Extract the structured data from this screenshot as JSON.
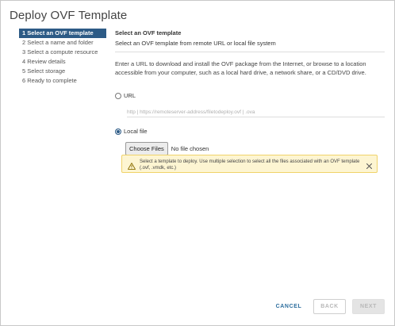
{
  "dialog": {
    "title": "Deploy OVF Template"
  },
  "steps": [
    {
      "label": "1 Select an OVF template",
      "active": true
    },
    {
      "label": "2 Select a name and folder",
      "active": false
    },
    {
      "label": "3 Select a compute resource",
      "active": false
    },
    {
      "label": "4 Review details",
      "active": false
    },
    {
      "label": "5 Select storage",
      "active": false
    },
    {
      "label": "6 Ready to complete",
      "active": false
    }
  ],
  "main": {
    "heading": "Select an OVF template",
    "subheading": "Select an OVF template from remote URL or local file system",
    "description": "Enter a URL to download and install the OVF package from the Internet, or browse to a location accessible from your computer, such as a local hard drive, a network share, or a CD/DVD drive.",
    "url_option": {
      "label": "URL",
      "selected": false
    },
    "url_input": {
      "placeholder": "http | https://remoteserver-address/filetodeploy.ovf | .ova",
      "value": ""
    },
    "local_option": {
      "label": "Local file",
      "selected": true
    },
    "choose_files_label": "Choose Files",
    "no_file_text": "No file chosen",
    "warning": {
      "text": "Select a template to deploy. Use multiple selection to select all the files associated with an OVF template (.ovf, .vmdk, etc.)",
      "icon": "warning-triangle-icon",
      "color": "#fdf5d2"
    }
  },
  "footer": {
    "cancel_label": "CANCEL",
    "back_label": "BACK",
    "next_label": "NEXT"
  },
  "colors": {
    "accent": "#2d5b86",
    "link": "#2d6e9e",
    "warning_border": "#f0d36a"
  }
}
